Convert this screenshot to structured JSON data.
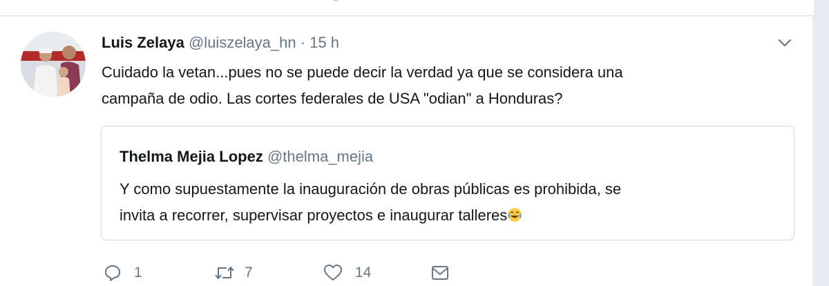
{
  "tweet": {
    "author_name": "Luis Zelaya",
    "author_handle": "@luiszelaya_hn",
    "separator": "·",
    "time": "15 h",
    "text_line1": "Cuidado la vetan...pues no se puede decir la verdad ya que se considera una",
    "text_line2": "campaña de odio. Las cortes federales de USA \"odian\" a Honduras?"
  },
  "quote": {
    "author_name": "Thelma Mejia Lopez",
    "author_handle": "@thelma_mejia",
    "text_line1": "Y como supuestamente la inauguración de obras públicas es prohibida, se",
    "text_line2": "invita a recorrer, supervisar proyectos e inaugurar talleres",
    "emoji": "face-with-tears-of-joy"
  },
  "actions": {
    "reply_count": "1",
    "retweet_count": "7",
    "like_count": "14"
  },
  "icons": {
    "reply": "reply-icon",
    "retweet": "retweet-icon",
    "like": "heart-icon",
    "message": "envelope-icon",
    "menu": "chevron-down-icon"
  },
  "colors": {
    "text_primary": "#14171a",
    "text_secondary": "#657786",
    "border": "#ccd6dd",
    "background": "#e6ecf0"
  }
}
